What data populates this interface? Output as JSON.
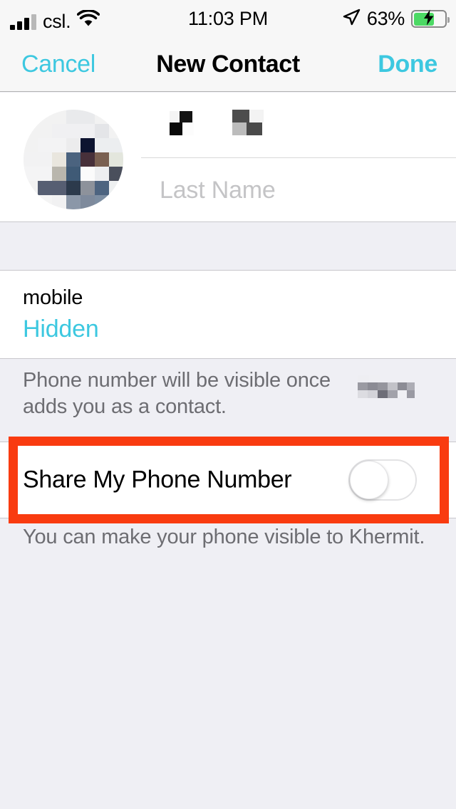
{
  "status_bar": {
    "carrier": "csl.",
    "time": "11:03 PM",
    "battery_percent": "63%",
    "battery_level": 63,
    "signal_bars_filled": 3,
    "signal_bars_total": 4,
    "wifi_icon": "wifi-icon",
    "location_icon": "location-arrow-icon",
    "battery_icon": "battery-charging-icon",
    "charging": true
  },
  "nav": {
    "cancel_label": "Cancel",
    "title": "New Contact",
    "done_label": "Done"
  },
  "name_section": {
    "avatar_icon": "contact-photo-avatar",
    "first_name_value": "",
    "first_name_redacted": true,
    "last_name_placeholder": "Last Name",
    "last_name_value": ""
  },
  "phone_section": {
    "label": "mobile",
    "value": "Hidden"
  },
  "note_phone_visibility": {
    "line1": "Phone number will be visible once",
    "line2": "adds you as a contact.",
    "redacted_name": true
  },
  "share_toggle": {
    "label": "Share My Phone Number",
    "state": "off",
    "checked": false
  },
  "note_share": {
    "text": "You can make your phone visible to Khermit."
  },
  "highlight": {
    "color": "#f93b10",
    "target": "share-my-phone-number-row"
  },
  "colors": {
    "accent": "#3dc8e0",
    "group_background": "#efeff4",
    "card_background": "#ffffff",
    "separator": "#c8c7cc",
    "secondary_text": "#6d6d72",
    "battery_green": "#4cd964",
    "highlight_red": "#f93b10"
  }
}
